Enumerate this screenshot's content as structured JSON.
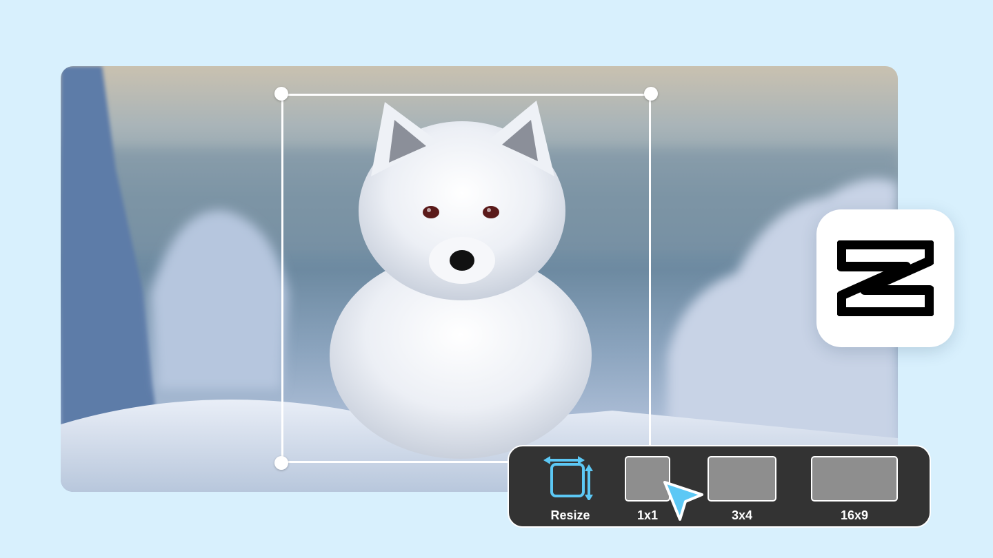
{
  "toolbar": {
    "resize_label": "Resize",
    "ratios": [
      {
        "label": "1x1"
      },
      {
        "label": "3x4"
      },
      {
        "label": "16x9"
      }
    ]
  },
  "icons": {
    "resize": "resize-icon",
    "logo": "capcut-logo-icon",
    "cursor": "pointer-cursor-icon"
  },
  "colors": {
    "background": "#d8f0fd",
    "toolbar": "#333333",
    "accent": "#5cc8f5",
    "ratio_fill": "#8e8e8e"
  }
}
